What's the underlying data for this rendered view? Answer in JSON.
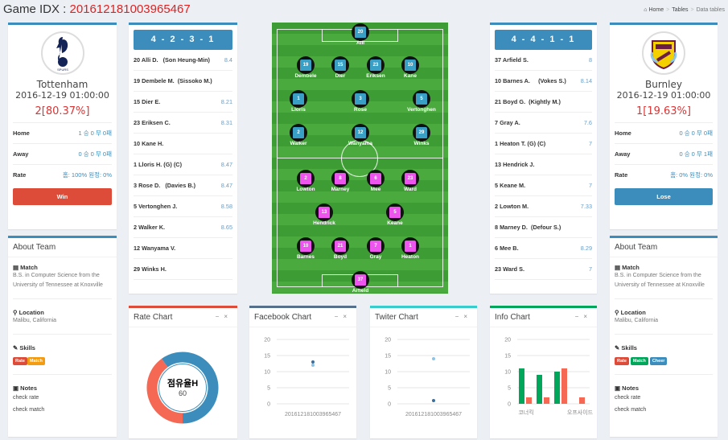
{
  "header": {
    "title_prefix": "Game IDX : ",
    "game_idx": "201612181003965467"
  },
  "breadcrumb": {
    "home": "Home",
    "tables": "Tables",
    "current": "Data tables",
    "sep": ">"
  },
  "home_team": {
    "name": "Tottenham",
    "date": "2016-12-19 01:00:00",
    "score": "2[80.37%]",
    "stats": [
      {
        "label": "Home",
        "value": "1 승 0 무 0패"
      },
      {
        "label": "Away",
        "value": "0 승 0 무 0패"
      },
      {
        "label": "Rate",
        "value": "홈: 100% 원정: 0%"
      }
    ],
    "result": "Win",
    "result_color": "#dd4b39"
  },
  "away_team": {
    "name": "Burnley",
    "date": "2016-12-19 01:00:00",
    "score": "1[19.63%]",
    "stats": [
      {
        "label": "Home",
        "value": "0 승 0 무 0패"
      },
      {
        "label": "Away",
        "value": "0 승 0 무 1패"
      },
      {
        "label": "Rate",
        "value": "홈: 0% 원정: 0%"
      }
    ],
    "result": "Lose",
    "result_color": "#3c8dbc"
  },
  "home_lineup": {
    "formation": "4 - 2 - 3 - 1",
    "players": [
      {
        "name": "20 Alli D.   (Son Heung-Min)",
        "rating": "8.4"
      },
      {
        "name": "19 Dembele M.  (Sissoko M.)",
        "rating": ""
      },
      {
        "name": "15 Dier E.",
        "rating": "8.21"
      },
      {
        "name": "23 Eriksen C.",
        "rating": "8.31"
      },
      {
        "name": "10 Kane H.",
        "rating": ""
      },
      {
        "name": "1 Lloris H. (G) (C)",
        "rating": "8.47"
      },
      {
        "name": "3 Rose D.   (Davies B.)",
        "rating": "8.47"
      },
      {
        "name": "5 Vertonghen J.",
        "rating": "8.58"
      },
      {
        "name": "2 Walker K.",
        "rating": "8.65"
      },
      {
        "name": "12 Wanyama V.",
        "rating": ""
      },
      {
        "name": "29 Winks H.",
        "rating": ""
      }
    ]
  },
  "away_lineup": {
    "formation": "4 - 4 - 1 - 1",
    "players": [
      {
        "name": "37 Arfield S.",
        "rating": "8"
      },
      {
        "name": "10 Barnes A.     (Vokes S.)",
        "rating": "8.14"
      },
      {
        "name": "21 Boyd G.  (Kightly M.)",
        "rating": ""
      },
      {
        "name": "7 Gray A.",
        "rating": "7.6"
      },
      {
        "name": "1 Heaton T. (G) (C)",
        "rating": "7"
      },
      {
        "name": "13 Hendrick J.",
        "rating": ""
      },
      {
        "name": "5 Keane M.",
        "rating": "7"
      },
      {
        "name": "2 Lowton M.",
        "rating": "7.33"
      },
      {
        "name": "8 Marney D.  (Defour S.)",
        "rating": ""
      },
      {
        "name": "6 Mee B.",
        "rating": "8.29"
      },
      {
        "name": "23 Ward S.",
        "rating": "7"
      }
    ]
  },
  "pitch": {
    "home_color": "#3a9fc4",
    "away_color": "#ee55ee",
    "home": [
      {
        "n": "20",
        "name": "Alli"
      },
      {
        "n": "19",
        "name": "Dembele"
      },
      {
        "n": "15",
        "name": "Dier"
      },
      {
        "n": "23",
        "name": "Eriksen"
      },
      {
        "n": "10",
        "name": "Kane"
      },
      {
        "n": "1",
        "name": "Lloris"
      },
      {
        "n": "3",
        "name": "Rose"
      },
      {
        "n": "5",
        "name": "Vertonghen"
      },
      {
        "n": "2",
        "name": "Walker"
      },
      {
        "n": "12",
        "name": "Wanyama"
      },
      {
        "n": "29",
        "name": "Winks"
      }
    ],
    "away": [
      {
        "n": "2",
        "name": "Lowton"
      },
      {
        "n": "8",
        "name": "Marney"
      },
      {
        "n": "6",
        "name": "Mee"
      },
      {
        "n": "23",
        "name": "Ward"
      },
      {
        "n": "13",
        "name": "Hendrick"
      },
      {
        "n": "5",
        "name": "Keane"
      },
      {
        "n": "10",
        "name": "Barnes"
      },
      {
        "n": "21",
        "name": "Boyd"
      },
      {
        "n": "7",
        "name": "Gray"
      },
      {
        "n": "1",
        "name": "Heaton"
      },
      {
        "n": "37",
        "name": "Arfield"
      }
    ]
  },
  "about": {
    "title": "About Team",
    "match_label": "Match",
    "match_text": "B.S. in Computer Science from the University of Tennessee at Knoxville",
    "location_label": "Location",
    "location_text": "Malibu, California",
    "skills_label": "Skills",
    "notes_label": "Notes",
    "notes": [
      "check rate",
      "check match"
    ],
    "home_skills": [
      {
        "label": "Rate",
        "color": "#dd4b39"
      },
      {
        "label": "Match",
        "color": "#f39c12"
      }
    ],
    "away_skills": [
      {
        "label": "Rate",
        "color": "#dd4b39"
      },
      {
        "label": "Match",
        "color": "#00a65a"
      },
      {
        "label": "Cheer",
        "color": "#3c8dbc"
      }
    ]
  },
  "chart_data": [
    {
      "type": "pie",
      "title": "Rate Chart",
      "center_label": "점유율H",
      "center_value": "60",
      "values": [
        60,
        40
      ],
      "colors": [
        "#3c8dbc",
        "#f56954"
      ]
    },
    {
      "type": "scatter",
      "title": "Facebook Chart",
      "categories": [
        "201612181003965467"
      ],
      "ylim": [
        0,
        20
      ],
      "yticks": [
        0,
        5,
        10,
        15,
        20
      ],
      "series": [
        {
          "values": [
            13
          ],
          "color": "#3c6e9c"
        },
        {
          "values": [
            12
          ],
          "color": "#8cc4e8"
        }
      ]
    },
    {
      "type": "scatter",
      "title": "Twiter Chart",
      "categories": [
        "201612181003965467"
      ],
      "ylim": [
        0,
        20
      ],
      "yticks": [
        0,
        5,
        10,
        15,
        20
      ],
      "series": [
        {
          "values": [
            14
          ],
          "color": "#8cc4e8"
        },
        {
          "values": [
            1
          ],
          "color": "#3c6e9c"
        }
      ]
    },
    {
      "type": "bar",
      "title": "Info Chart",
      "category_labels_shown": [
        "코너킥",
        "오프사이드"
      ],
      "ylim": [
        0,
        20
      ],
      "yticks": [
        0,
        5,
        10,
        15,
        20
      ],
      "series": [
        {
          "values": [
            11,
            9,
            10,
            0
          ],
          "color": "#00a65a"
        },
        {
          "values": [
            2,
            2,
            11,
            2
          ],
          "color": "#f56954"
        }
      ]
    }
  ],
  "box_tools": {
    "minimize": "−",
    "close": "×"
  }
}
